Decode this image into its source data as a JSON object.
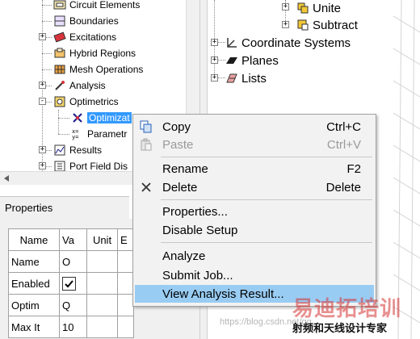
{
  "project_tree": {
    "items": [
      {
        "label": "Circuit Elements",
        "icon": "circuit-elements-icon",
        "expander": ""
      },
      {
        "label": "Boundaries",
        "icon": "boundaries-icon",
        "expander": ""
      },
      {
        "label": "Excitations",
        "icon": "excitations-icon",
        "expander": "+"
      },
      {
        "label": "Hybrid Regions",
        "icon": "hybrid-regions-icon",
        "expander": ""
      },
      {
        "label": "Mesh Operations",
        "icon": "mesh-operations-icon",
        "expander": ""
      },
      {
        "label": "Analysis",
        "icon": "analysis-icon",
        "expander": "+"
      },
      {
        "label": "Optimetrics",
        "icon": "optimetrics-icon",
        "expander": "-"
      },
      {
        "label": "Optimizat",
        "icon": "optimization-icon",
        "expander": "",
        "selected": true
      },
      {
        "label": "Parametr",
        "icon": "parametric-icon",
        "expander": ""
      },
      {
        "label": "Results",
        "icon": "results-icon",
        "expander": "+"
      },
      {
        "label": "Port Field Dis",
        "icon": "port-field-icon",
        "expander": "+"
      }
    ]
  },
  "properties": {
    "title": "Properties",
    "columns": [
      "Name",
      "Va",
      "Unit",
      "E"
    ],
    "rows": [
      {
        "name": "Name",
        "value": "O"
      },
      {
        "name": "Enabled",
        "value": "",
        "checked": true
      },
      {
        "name": "Optim",
        "value": "Q"
      },
      {
        "name": "Max It",
        "value": "10"
      }
    ]
  },
  "model_tree": {
    "items": [
      {
        "label": "Unite",
        "icon": "unite-icon",
        "expander": "+"
      },
      {
        "label": "Subtract",
        "icon": "subtract-icon",
        "expander": "+"
      },
      {
        "label": "Coordinate Systems",
        "icon": "coordinate-systems-icon",
        "expander": "+"
      },
      {
        "label": "Planes",
        "icon": "planes-icon",
        "expander": "+"
      },
      {
        "label": "Lists",
        "icon": "lists-icon",
        "expander": "+"
      }
    ]
  },
  "context_menu": {
    "items": [
      {
        "label": "Copy",
        "shortcut": "Ctrl+C",
        "icon": "copy-icon",
        "disabled": false
      },
      {
        "label": "Paste",
        "shortcut": "Ctrl+V",
        "icon": "paste-icon",
        "disabled": true
      },
      {
        "label": "Rename",
        "shortcut": "F2",
        "icon": "",
        "disabled": false
      },
      {
        "label": "Delete",
        "shortcut": "Delete",
        "icon": "delete-icon",
        "disabled": false
      },
      {
        "label": "Properties...",
        "shortcut": "",
        "icon": "",
        "disabled": false
      },
      {
        "label": "Disable Setup",
        "shortcut": "",
        "icon": "",
        "disabled": false
      },
      {
        "label": "Analyze",
        "shortcut": "",
        "icon": "",
        "disabled": false
      },
      {
        "label": "Submit Job...",
        "shortcut": "",
        "icon": "",
        "disabled": false
      },
      {
        "label": "View Analysis Result...",
        "shortcut": "",
        "icon": "",
        "disabled": false,
        "highlighted": true
      }
    ]
  },
  "watermark": {
    "title": "易迪拓培训",
    "subtitle": "射频和天线设计专家",
    "url": "https://blog.csdn.net/qq_"
  },
  "colors": {
    "selection": "#3399ff",
    "menu_highlight": "#99ccf3",
    "watermark_red": "#d63434"
  }
}
